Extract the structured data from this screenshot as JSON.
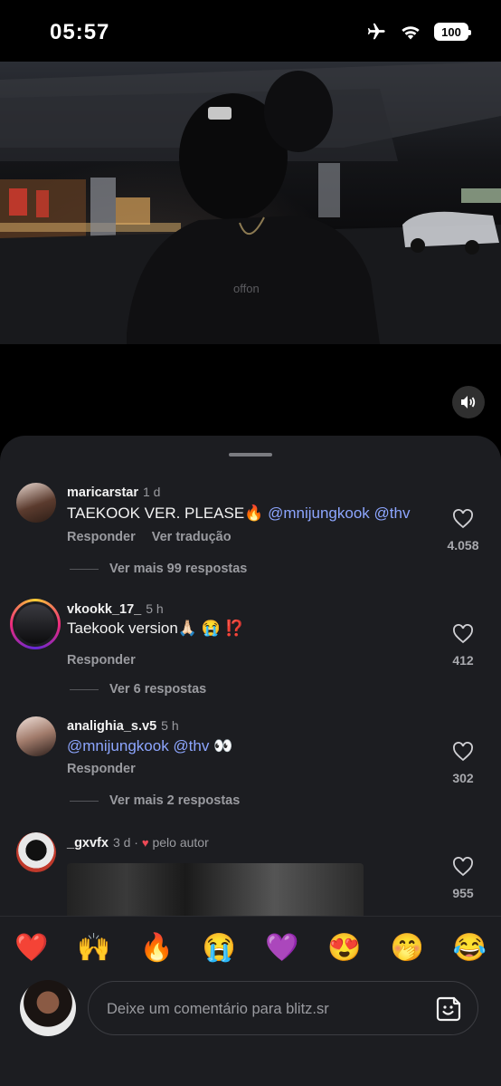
{
  "status_bar": {
    "time": "05:57",
    "battery": "100"
  },
  "video": {
    "shirt_text": "offon"
  },
  "comments": [
    {
      "user": "maricarstar",
      "time": "1 d",
      "text": "TAEKOOK VER. PLEASE🔥 ",
      "mentions": "@mnijungkook @thv",
      "reply_label": "Responder",
      "translate_label": "Ver tradução",
      "more_replies": "Ver mais 99 respostas",
      "likes": "4.058"
    },
    {
      "user": "vkookk_17_",
      "time": "5 h",
      "text": "Taekook version🙏🏻 😭 ⁉️",
      "reply_label": "Responder",
      "more_replies": "Ver 6 respostas",
      "likes": "412"
    },
    {
      "user": "analighia_s.v5",
      "time": "5 h",
      "mentions": "@mnijungkook @thv",
      "text": " 👀",
      "reply_label": "Responder",
      "more_replies": "Ver mais 2 respostas",
      "likes": "302"
    },
    {
      "user": "_gxvfx",
      "time": "3 d ·",
      "author_liked": "pelo autor",
      "likes": "955"
    }
  ],
  "emoji_bar": [
    "❤️",
    "🙌",
    "🔥",
    "😭",
    "💜",
    "😍",
    "🤭",
    "😂"
  ],
  "comment_input": {
    "placeholder": "Deixe um comentário para blitz.sr"
  },
  "colors": {
    "sheet_bg": "#1c1d21",
    "mention": "#8da6ff",
    "muted_text": "#9a9ba0"
  }
}
